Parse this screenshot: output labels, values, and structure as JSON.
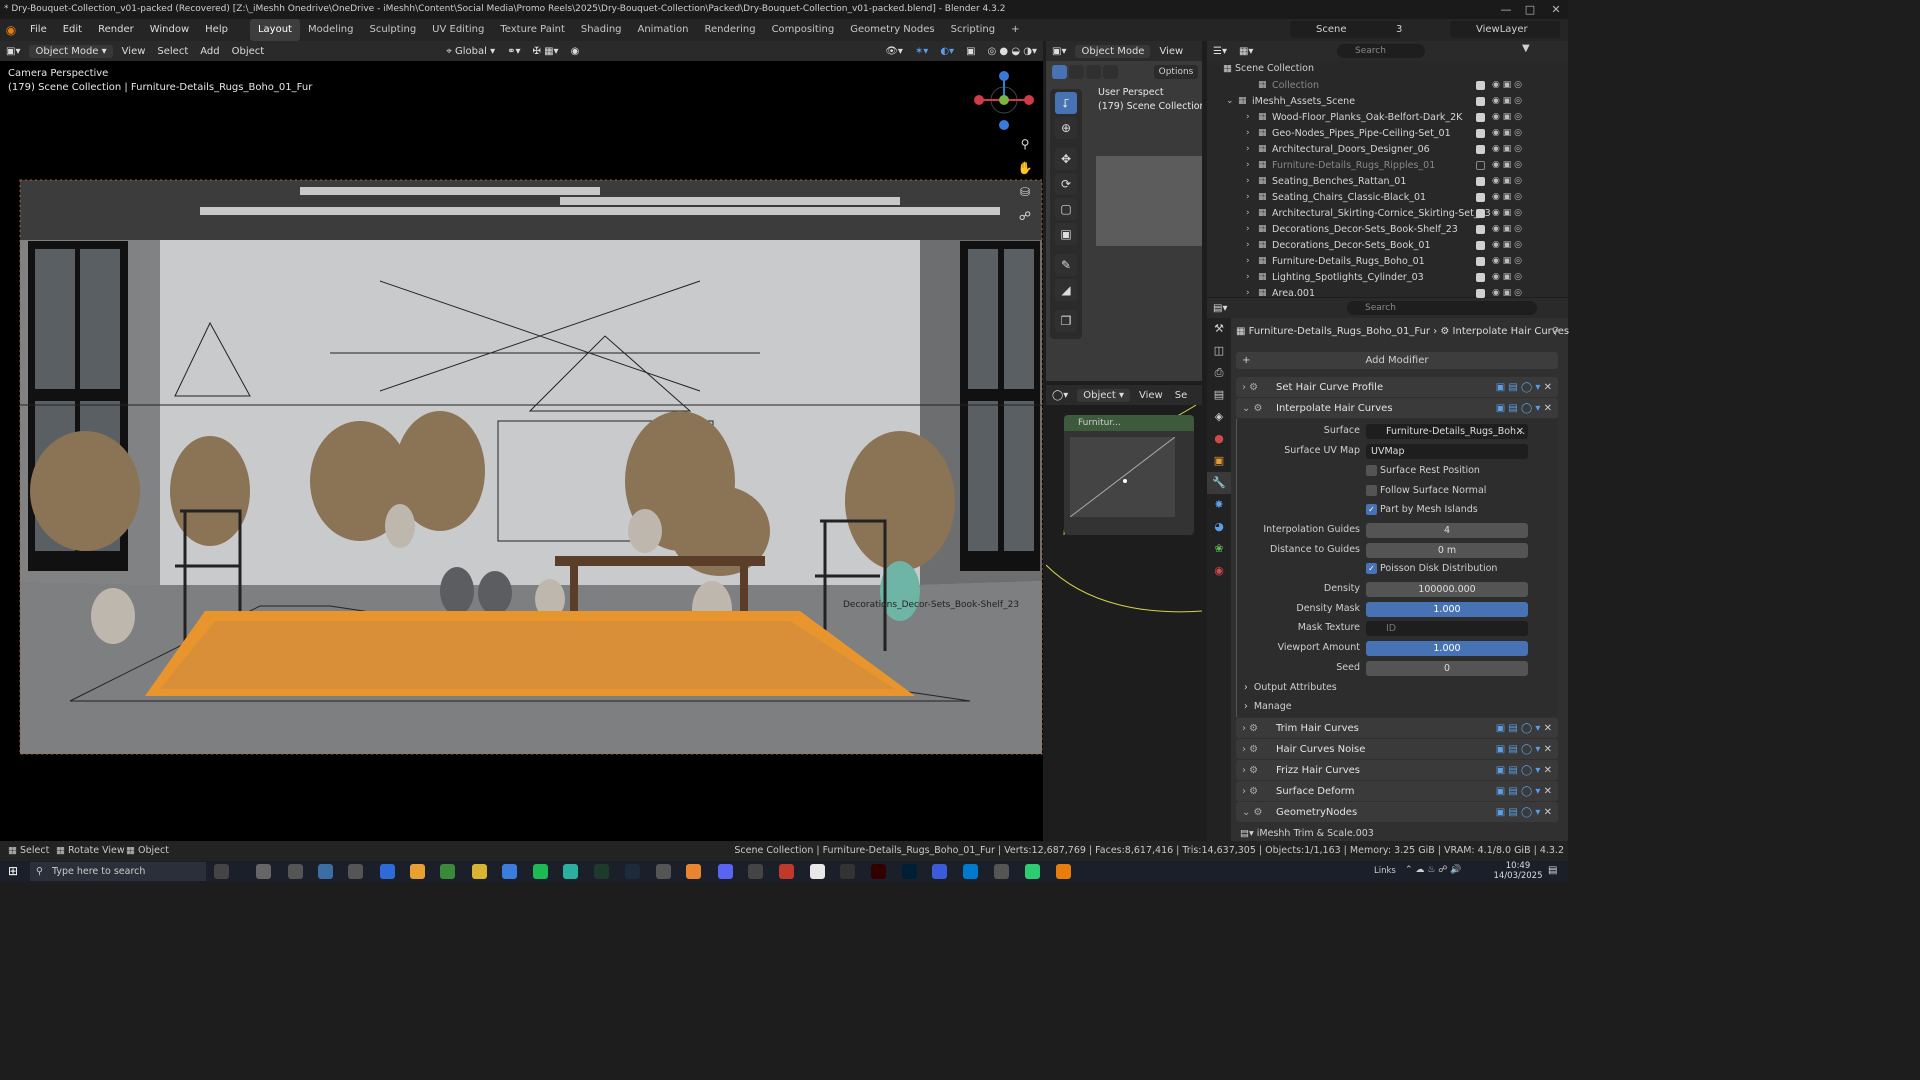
{
  "window": {
    "title": "* Dry-Bouquet-Collection_v01-packed (Recovered) [Z:\\_iMeshh Onedrive\\OneDrive - iMeshh\\Content\\Social Media\\Promo Reels\\2025\\Dry-Bouquet-Collection\\Packed\\Dry-Bouquet-Collection_v01-packed.blend] - Blender 4.3.2"
  },
  "menu": [
    "File",
    "Edit",
    "Render",
    "Window",
    "Help"
  ],
  "workspaces": [
    "Layout",
    "Modeling",
    "Sculpting",
    "UV Editing",
    "Texture Paint",
    "Shading",
    "Animation",
    "Rendering",
    "Compositing",
    "Geometry Nodes",
    "Scripting"
  ],
  "top_right": {
    "scene": "Scene",
    "scene_count": "3",
    "view_layer": "ViewLayer"
  },
  "viewport_header": {
    "mode": "Object Mode",
    "view": "View",
    "select": "Select",
    "add": "Add",
    "object": "Object",
    "transform": "Global"
  },
  "viewport": {
    "line1": "Camera Perspective",
    "line2": "(179) Scene Collection | Furniture-Details_Rugs_Boho_01_Fur",
    "obj_label": "Decorations_Decor-Sets_Book-Shelf_23"
  },
  "mini_view": {
    "mode": "Object Mode",
    "view": "View",
    "options": "Options",
    "line1": "User Perspect",
    "line2": "(179) Scene Collection | "
  },
  "node_ed": {
    "mode": "Object",
    "view": "View",
    "extra": "Se",
    "node_title": "Furnitur..."
  },
  "outliner": {
    "search": "Search",
    "root": "Scene Collection",
    "rows": [
      {
        "name": "Collection"
      },
      {
        "name": "iMeshh_Assets_Scene"
      },
      {
        "name": "Wood-Floor_Planks_Oak-Belfort-Dark_2K"
      },
      {
        "name": "Geo-Nodes_Pipes_Pipe-Ceiling-Set_01"
      },
      {
        "name": "Architectural_Doors_Designer_06"
      },
      {
        "name": "Furniture-Details_Rugs_Ripples_01"
      },
      {
        "name": "Seating_Benches_Rattan_01"
      },
      {
        "name": "Seating_Chairs_Classic-Black_01"
      },
      {
        "name": "Architectural_Skirting-Cornice_Skirting-Set_03"
      },
      {
        "name": "Decorations_Decor-Sets_Book-Shelf_23"
      },
      {
        "name": "Decorations_Decor-Sets_Book_01"
      },
      {
        "name": "Furniture-Details_Rugs_Boho_01"
      },
      {
        "name": "Lighting_Spotlights_Cylinder_03"
      },
      {
        "name": "Area.001"
      }
    ]
  },
  "properties": {
    "search": "Search",
    "object": "Furniture-Details_Rugs_Boho_01_Fur",
    "modifier": "Interpolate Hair Curves",
    "add_modifier": "Add Modifier",
    "mod1": "Set Hair Curve Profile",
    "mod2": "Interpolate Hair Curves",
    "surface_label": "Surface",
    "surface_value": "Furniture-Details_Rugs_Boh...",
    "uv_label": "Surface UV Map",
    "uv_value": "UVMap",
    "rest_label": "Surface Rest Position",
    "follow_label": "Follow Surface Normal",
    "islands_label": "Part by Mesh Islands",
    "guides_label": "Interpolation Guides",
    "guides_value": "4",
    "dist_label": "Distance to Guides",
    "dist_value": "0 m",
    "poisson_label": "Poisson Disk Distribution",
    "density_label": "Density",
    "density_value": "100000.000",
    "dmask_label": "Density Mask",
    "dmask_value": "1.000",
    "mtex_label": "Mask Texture",
    "mtex_value": "ID",
    "vamount_label": "Viewport Amount",
    "vamount_value": "1.000",
    "seed_label": "Seed",
    "seed_value": "0",
    "output_attrs": "Output Attributes",
    "manage": "Manage",
    "mods_after": [
      "Trim Hair Curves",
      "Hair Curves Noise",
      "Frizz Hair Curves",
      "Surface Deform",
      "GeometryNodes"
    ],
    "trim_group": "iMeshh Trim & Scale.003"
  },
  "status": {
    "select": "Select",
    "rotate": "Rotate View",
    "object": "Object",
    "info": "Scene Collection | Furniture-Details_Rugs_Boho_01_Fur | Verts:12,687,769 | Faces:8,617,416 | Tris:14,637,305 | Objects:1/1,163 | Memory: 3.25 GiB | VRAM: 4.1/8.0 GiB | 4.3.2"
  },
  "taskbar": {
    "search": "Type here to search",
    "time": "10:49",
    "date": "14/03/2025",
    "links": "Links"
  }
}
